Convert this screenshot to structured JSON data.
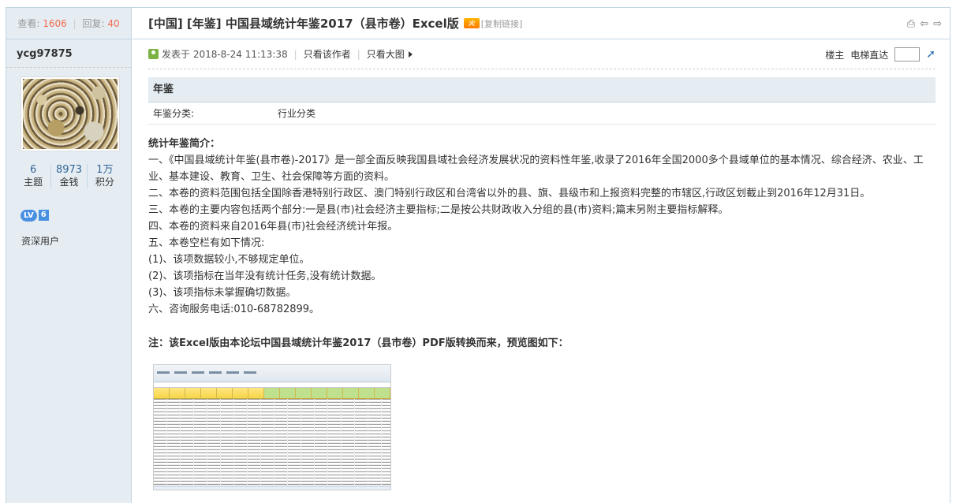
{
  "sidebar": {
    "views_label": "查看:",
    "views": "1606",
    "replies_label": "回复:",
    "replies": "40",
    "username": "ycg97875",
    "stats": [
      {
        "value": "6",
        "label": "主题"
      },
      {
        "value": "8973",
        "label": "金钱"
      },
      {
        "value": "1万",
        "label": "积分"
      }
    ],
    "level_badge": "LV",
    "level_num": "6",
    "user_group": "资深用户"
  },
  "thread": {
    "title": "[中国] [年鉴] 中国县域统计年鉴2017（县市卷）Excel版",
    "hot_badge": "火",
    "copy_link": "[复制链接]"
  },
  "meta": {
    "posted_at": "发表于 2018-8-24 11:13:38",
    "only_author": "只看该作者",
    "big_image": "只看大图",
    "floor": "楼主",
    "jump_label": "电梯直达"
  },
  "typeoption": {
    "heading": "年鉴",
    "key": "年鉴分类:",
    "value": "行业分类"
  },
  "content": {
    "heading": "统计年鉴简介：",
    "lines": [
      "一、《中国县域统计年鉴(县市卷)-2017》是一部全面反映我国县域社会经济发展状况的资料性年鉴,收录了2016年全国2000多个县域单位的基本情况、综合经济、农业、工业、基本建设、教育、卫生、社会保障等方面的资料。",
      "二、本卷的资料范围包括全国除香港特别行政区、澳门特别行政区和台湾省以外的县、旗、县级市和上报资料完整的市辖区,行政区划截止到2016年12月31日。",
      "三、本卷的主要内容包括两个部分:一是县(市)社会经济主要指标;二是按公共财政收入分组的县(市)资料;篇末另附主要指标解释。",
      "四、本卷的资料来自2016年县(市)社会经济统计年报。",
      "五、本卷空栏有如下情况:",
      "(1)、该项数据较小,不够规定单位。",
      "(2)、该项指标在当年没有统计任务,没有统计数据。",
      "(3)、该项指标未掌握确切数据。",
      "六、咨询服务电话:010-68782899。"
    ],
    "note": "注：该Excel版由本论坛中国县域统计年鉴2017（县市卷）PDF版转换而来，预览图如下："
  }
}
